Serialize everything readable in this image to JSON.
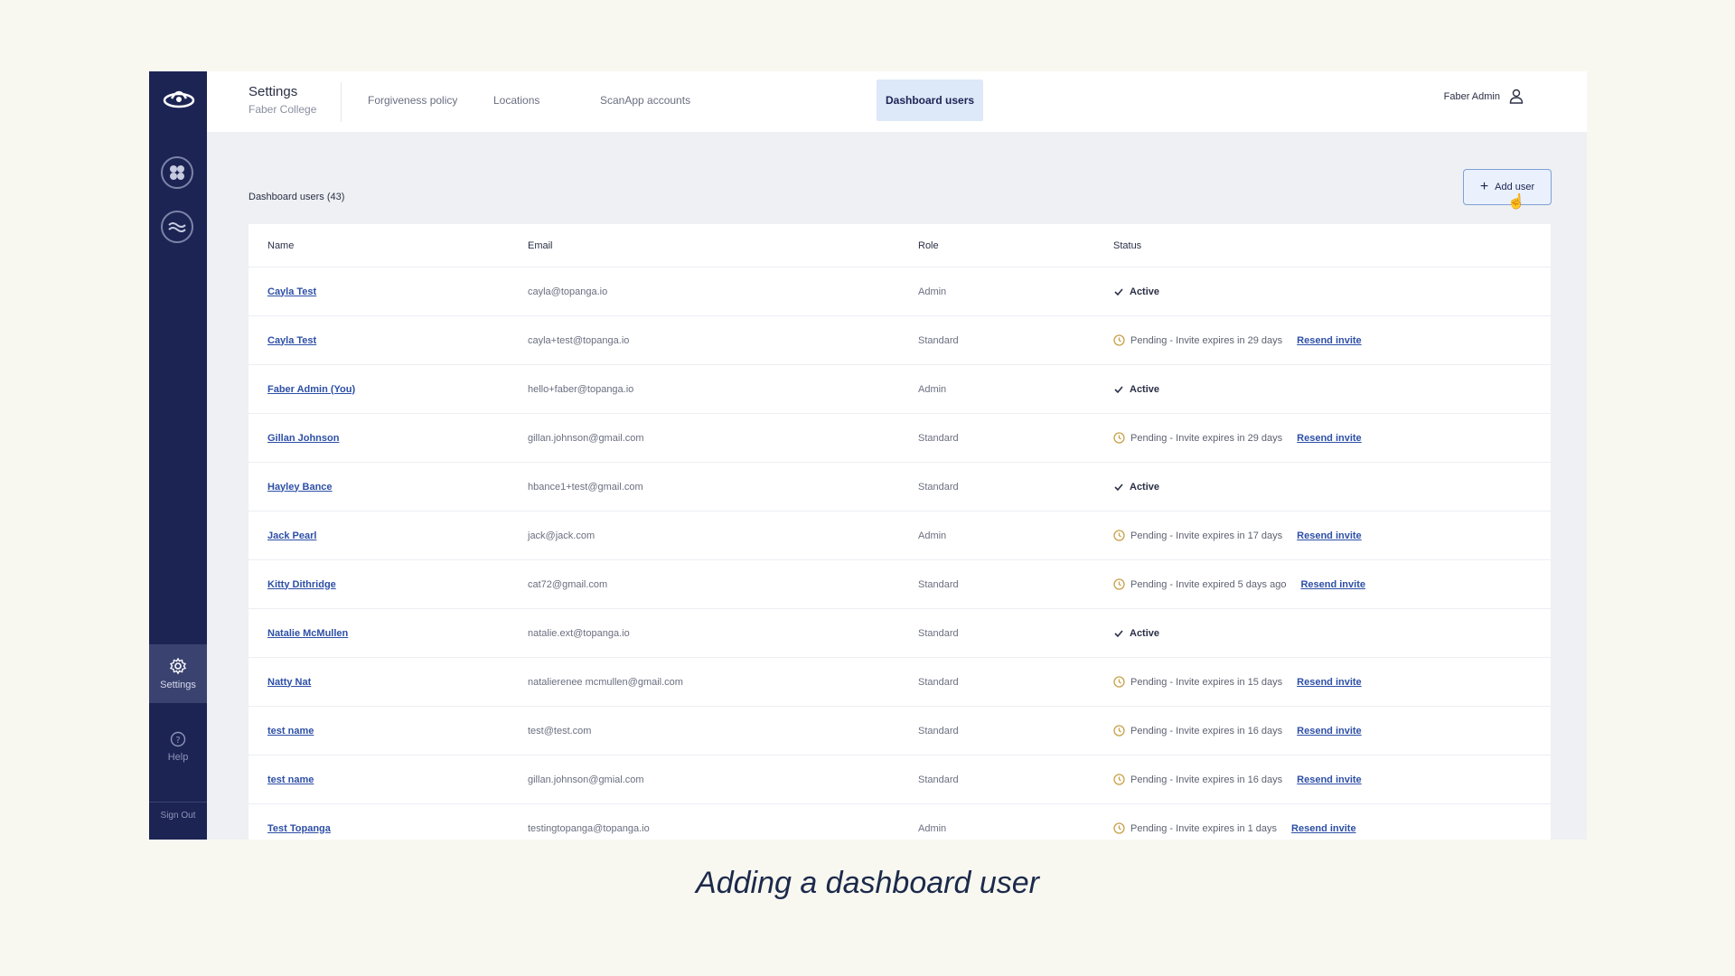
{
  "sidebar": {
    "settings_label": "Settings",
    "help_label": "Help",
    "signout_label": "Sign Out"
  },
  "header": {
    "title": "Settings",
    "subtitle": "Faber College",
    "tabs": [
      {
        "label": "Forgiveness policy"
      },
      {
        "label": "Locations"
      },
      {
        "label": "ScanApp accounts"
      },
      {
        "label": "Dashboard users",
        "active": true
      }
    ],
    "user_name": "Faber Admin"
  },
  "main": {
    "count_label": "Dashboard users (43)",
    "add_button_label": "Add user",
    "columns": {
      "name": "Name",
      "email": "Email",
      "role": "Role",
      "status": "Status"
    },
    "resend_label": "Resend invite",
    "rows": [
      {
        "name": "Cayla Test",
        "email": "cayla@topanga.io",
        "role": "Admin",
        "status": "Active",
        "pending": false
      },
      {
        "name": "Cayla Test",
        "email": "cayla+test@topanga.io",
        "role": "Standard",
        "status": "Pending - Invite expires in 29 days",
        "pending": true
      },
      {
        "name": "Faber Admin (You)",
        "email": "hello+faber@topanga.io",
        "role": "Admin",
        "status": "Active",
        "pending": false
      },
      {
        "name": "Gillan Johnson",
        "email": "gillan.johnson@gmail.com",
        "role": "Standard",
        "status": "Pending - Invite expires in 29 days",
        "pending": true
      },
      {
        "name": "Hayley Bance",
        "email": "hbance1+test@gmail.com",
        "role": "Standard",
        "status": "Active",
        "pending": false
      },
      {
        "name": "Jack Pearl",
        "email": "jack@jack.com",
        "role": "Admin",
        "status": "Pending - Invite expires in 17 days",
        "pending": true
      },
      {
        "name": "Kitty Dithridge",
        "email": "cat72@gmail.com",
        "role": "Standard",
        "status": "Pending - Invite expired 5 days ago",
        "pending": true
      },
      {
        "name": "Natalie McMullen",
        "email": "natalie.ext@topanga.io",
        "role": "Standard",
        "status": "Active",
        "pending": false
      },
      {
        "name": "Natty Nat",
        "email": "natalierenee mcmullen@gmail.com",
        "role": "Standard",
        "status": "Pending - Invite expires in 15 days",
        "pending": true
      },
      {
        "name": "test name",
        "email": "test@test.com",
        "role": "Standard",
        "status": "Pending - Invite expires in 16 days",
        "pending": true
      },
      {
        "name": "test name",
        "email": "gillan.johnson@gmial.com",
        "role": "Standard",
        "status": "Pending - Invite expires in 16 days",
        "pending": true
      },
      {
        "name": "Test Topanga",
        "email": "testingtopanga@topanga.io",
        "role": "Admin",
        "status": "Pending - Invite expires in 1 days",
        "pending": true
      }
    ]
  },
  "caption": "Adding a dashboard user"
}
